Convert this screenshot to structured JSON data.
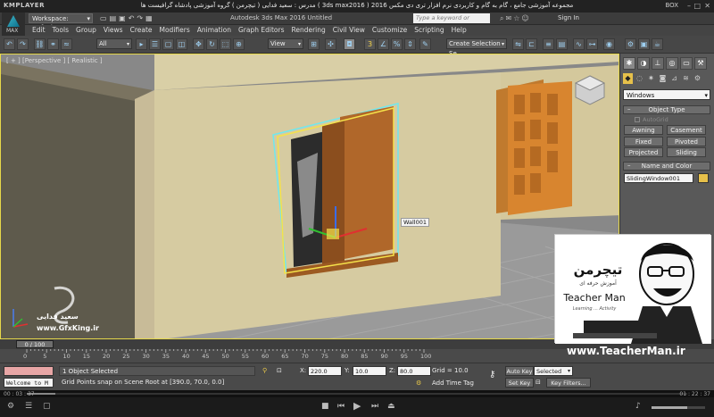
{
  "player": {
    "brand": "KMPLAYER",
    "caption": "مجموعه آموزشی جامع ، گام به گام و کاربردی نرم افزار تری دی مکس 2016 ( 3ds max2016 )    مدرس : سعید فدایی ( تیچرمن ) گروه آموزشی پادشاه گرافیست ها",
    "box_label": "BOX",
    "time_elapsed": "00 : 03 : 37",
    "time_total": "01 : 22 : 37"
  },
  "max": {
    "logo_label": "MAX",
    "workspace": "Workspace: Default",
    "app_title": "Autodesk 3ds Max 2016    Untitled",
    "search_placeholder": "Type a keyword or phrase",
    "sign_in": "Sign In",
    "menu": [
      "Edit",
      "Tools",
      "Group",
      "Views",
      "Create",
      "Modifiers",
      "Animation",
      "Graph Editors",
      "Rendering",
      "Civil View",
      "Customize",
      "Scripting",
      "Help"
    ],
    "toolbar": {
      "filter": "All",
      "refcoord": "View",
      "selset_placeholder": "Create Selection Se"
    }
  },
  "viewport": {
    "label": "[ + ] [Perspective ] [ Realistic ]",
    "object_tooltip": "Wall001",
    "watermark_name": "سعید فدایی",
    "watermark_site": "www.GfxKing.ir"
  },
  "command_panel": {
    "category": "Windows",
    "rollout_object_type": "Object Type",
    "autogrid": "AutoGrid",
    "buttons": [
      "Awning",
      "Casement",
      "Fixed",
      "Pivoted",
      "Projected",
      "Sliding"
    ],
    "rollout_name_color": "Name and Color",
    "object_name": "SlidingWindow001",
    "swatch_color": "#e6c04a"
  },
  "branding": {
    "teacherman_site": "www.TeacherMan.ir",
    "persian_name": "تیچرمن",
    "persian_sub": "آموزش حرفه ای",
    "english_name": "Teacher Man",
    "tagline": "Learning ... Activity"
  },
  "timeline": {
    "thumb": "0 / 100",
    "ticks": [
      "0",
      "5",
      "10",
      "15",
      "20",
      "25",
      "30",
      "35",
      "40",
      "45",
      "50",
      "55",
      "60",
      "65",
      "70",
      "75",
      "80",
      "85",
      "90",
      "95",
      "100"
    ]
  },
  "status": {
    "welcome": "Welcome to M",
    "selected": "1 Object Selected",
    "prompt": "Grid Points snap on Scene Root at [390.0, 70.0, 0.0]",
    "x_label": "X:",
    "x": "220.0",
    "y_label": "Y:",
    "y": "10.0",
    "z_label": "Z:",
    "z": "80.0",
    "grid": "Grid = 10.0",
    "add_time_tag": "Add Time Tag",
    "auto_key": "Auto Key",
    "set_key": "Set Key",
    "key_mode": "Selected",
    "key_filters": "Key Filters...",
    "frame": "0"
  }
}
